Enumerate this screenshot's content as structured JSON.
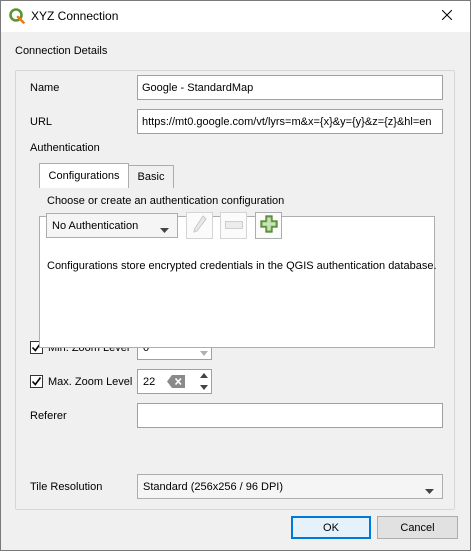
{
  "window": {
    "title": "XYZ Connection",
    "app_icon": "qgis-icon",
    "close_icon": "close-icon"
  },
  "group": {
    "title": "Connection Details"
  },
  "name": {
    "label": "Name",
    "value": "Google - StandardMap"
  },
  "url": {
    "label": "URL",
    "value": "https://mt0.google.com/vt/lyrs=m&x={x}&y={y}&z={z}&hl=en"
  },
  "authentication": {
    "label": "Authentication",
    "tabs": [
      {
        "label": "Configurations",
        "active": true
      },
      {
        "label": "Basic",
        "active": false
      }
    ],
    "choose_label": "Choose or create an authentication configuration",
    "selected_config": "No Authentication",
    "info_text": "Configurations store encrypted credentials in the QGIS authentication database.",
    "buttons": {
      "edit": "pencil-icon",
      "remove": "remove-icon",
      "add": "add-icon"
    }
  },
  "min_zoom": {
    "label": "Min. Zoom Level",
    "checked": true,
    "value": "0"
  },
  "max_zoom": {
    "label": "Max. Zoom Level",
    "checked": true,
    "value": "22",
    "clear_icon": "clear-icon"
  },
  "referer": {
    "label": "Referer",
    "value": ""
  },
  "tile_resolution": {
    "label": "Tile Resolution",
    "selected": "Standard (256x256 / 96 DPI)"
  },
  "dialog_buttons": {
    "ok": "OK",
    "cancel": "Cancel"
  },
  "colors": {
    "accent": "#0078d7",
    "window_bg": "#f0f0f0",
    "qgis_green": "#589632"
  }
}
